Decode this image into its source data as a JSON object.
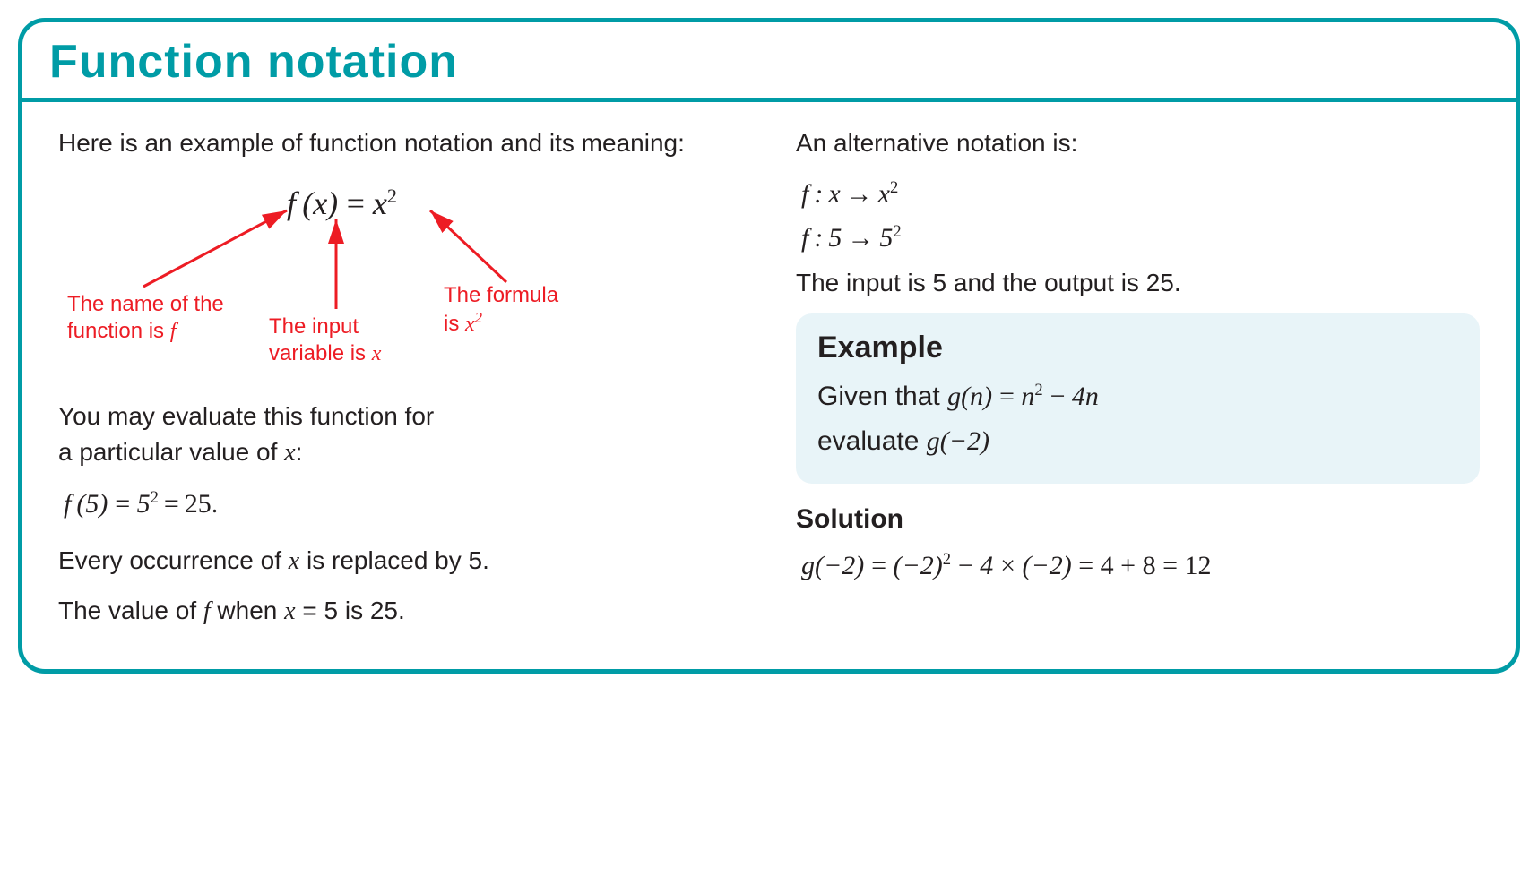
{
  "title": "Function notation",
  "left": {
    "intro": "Here is an example of function notation and its meaning:",
    "formula_html": "f (x) = x",
    "formula_exp": "2",
    "ann_name_l1": "The name of the",
    "ann_name_l2": "function is ",
    "ann_name_l2_it": "f",
    "ann_input_l1": "The input",
    "ann_input_l2": "variable is ",
    "ann_input_l2_it": "x",
    "ann_formula_l1": "The formula",
    "ann_formula_l2_a": "is ",
    "ann_formula_l2_it": "x",
    "ann_formula_l2_exp": "2",
    "eval_intro_l1": "You may evaluate this function for",
    "eval_intro_l2": "a particular value of ",
    "eval_intro_l2_it": "x",
    "eval_intro_l2_end": ":",
    "eval_eq_a": "f (5) = 5",
    "eval_eq_exp": "2",
    "eval_eq_b": " = 25.",
    "replace_a": "Every occurrence of ",
    "replace_it": "x",
    "replace_b": " is replaced by 5.",
    "value_a": "The value of ",
    "value_it": "f",
    "value_b": " when ",
    "value_it2": "x",
    "value_c": " = 5 is 25."
  },
  "right": {
    "alt_intro": "An alternative notation is:",
    "alt_line1_a": "f : x → x",
    "alt_line1_exp": "2",
    "alt_line2_a": "f : 5 → 5",
    "alt_line2_exp": "2",
    "alt_out": "The input is 5 and the output is 25.",
    "example_hdr": "Example",
    "example_given_a": "Given that  ",
    "example_given_b": "g(n) = n",
    "example_given_exp": "2",
    "example_given_c": " − 4n",
    "example_eval_a": "evaluate  ",
    "example_eval_b": "g(−2)",
    "solution_hdr": "Solution",
    "solution_a": "g(−2) = (−2)",
    "solution_exp": "2",
    "solution_b": " − 4 × (−2)",
    "solution_c": "  =  4  +  8  =  12"
  }
}
